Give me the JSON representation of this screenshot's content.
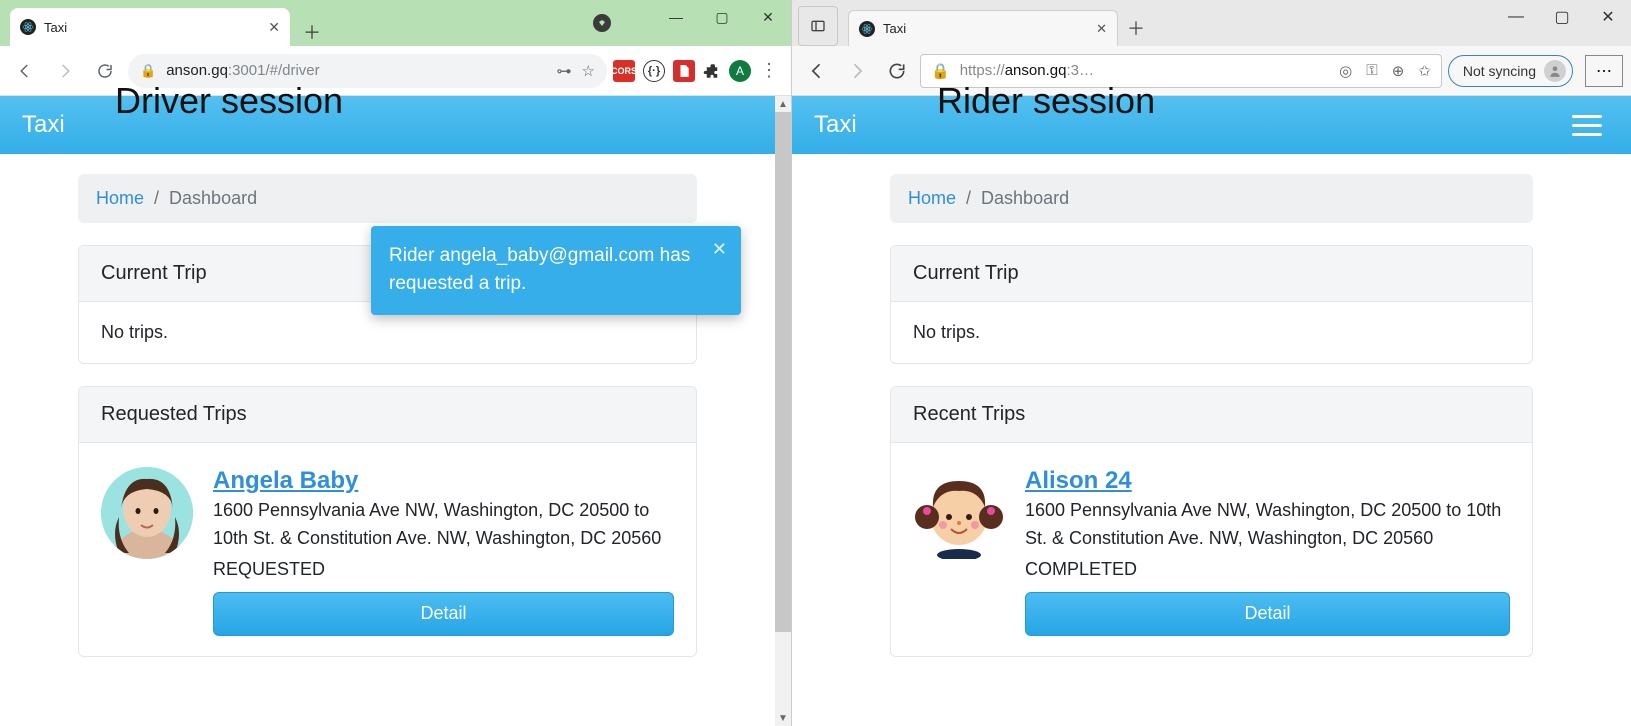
{
  "left": {
    "browser": {
      "tab_title": "Taxi",
      "url_host": "anson.gq",
      "url_rest": ":3001/#/driver"
    },
    "session_label": "Driver session",
    "app": {
      "brand": "Taxi",
      "breadcrumb": {
        "home": "Home",
        "sep": "/",
        "current": "Dashboard"
      },
      "toast": {
        "message": "Rider angela_baby@gmail.com has requested a trip."
      },
      "sections": {
        "current": {
          "title": "Current Trip",
          "empty": "No trips."
        },
        "requested": {
          "title": "Requested Trips",
          "trip": {
            "name": "Angela Baby",
            "from_to": "1600 Pennsylvania Ave NW, Washington, DC 20500 to 10th St. & Constitution Ave. NW, Washington, DC 20560",
            "status": "REQUESTED",
            "button": "Detail"
          }
        }
      }
    }
  },
  "right": {
    "browser": {
      "tab_title": "Taxi",
      "url_prefix": "https://",
      "url_host": "anson.gq",
      "url_rest": ":3…",
      "sync_label": "Not syncing"
    },
    "session_label": "Rider session",
    "app": {
      "brand": "Taxi",
      "breadcrumb": {
        "home": "Home",
        "sep": "/",
        "current": "Dashboard"
      },
      "sections": {
        "current": {
          "title": "Current Trip",
          "empty": "No trips."
        },
        "recent": {
          "title": "Recent Trips",
          "trip": {
            "name": "Alison 24",
            "from_to": "1600 Pennsylvania Ave NW, Washington, DC 20500 to 10th St. & Constitution Ave. NW, Washington, DC 20560",
            "status": "COMPLETED",
            "button": "Detail"
          }
        }
      }
    }
  }
}
